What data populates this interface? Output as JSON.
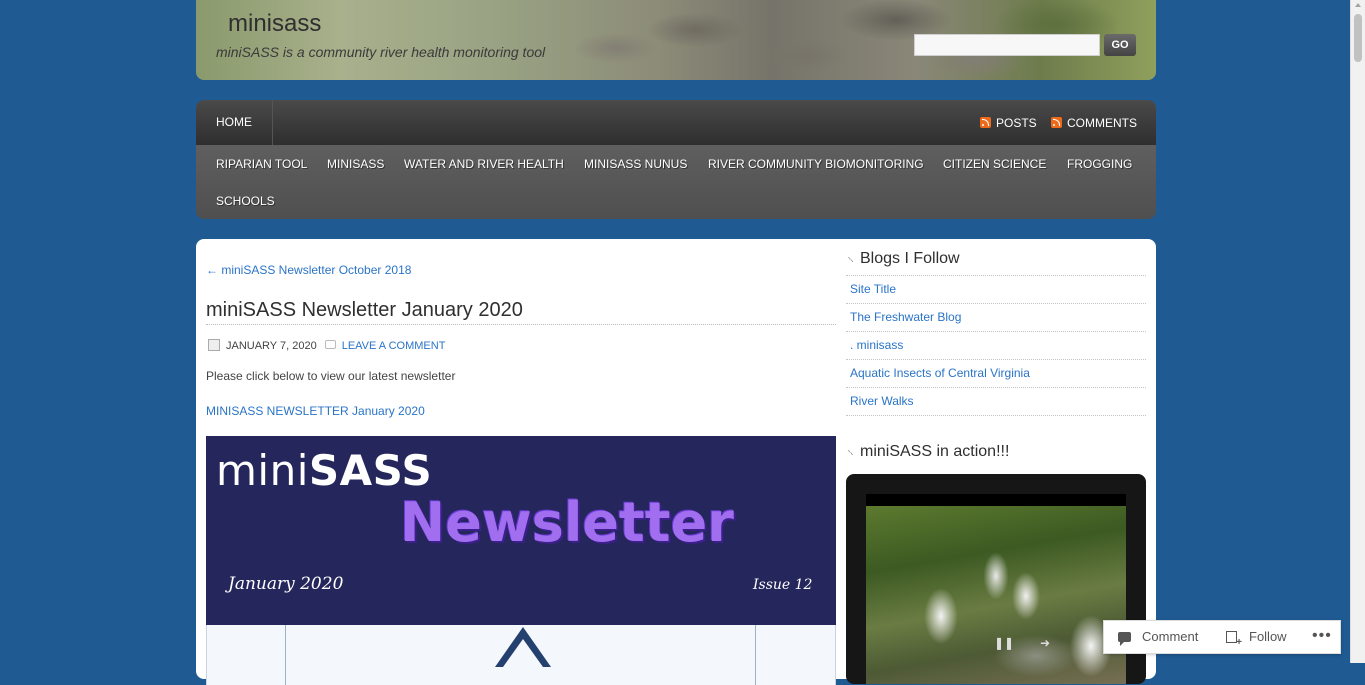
{
  "header": {
    "title": "minisass",
    "description": "miniSASS is a community river health monitoring tool",
    "search_placeholder": "",
    "search_button": "GO"
  },
  "nav": {
    "home": "HOME",
    "feeds": [
      "POSTS",
      "COMMENTS"
    ],
    "categories": [
      "RIPARIAN TOOL",
      "MINISASS",
      "WATER AND RIVER HEALTH",
      "MINISASS NUNUS",
      "RIVER COMMUNITY BIOMONITORING",
      "CITIZEN SCIENCE",
      "FROGGING",
      "SCHOOLS"
    ]
  },
  "post": {
    "prev_link": "← miniSASS Newsletter October 2018",
    "title": "miniSASS Newsletter January 2020",
    "date": "JANUARY 7, 2020",
    "comment_link": "LEAVE A COMMENT",
    "intro": "Please click below to view our latest newsletter",
    "newsletter_link": "MINISASS NEWSLETTER January 2020",
    "newsletter_image": {
      "mini": "mini",
      "sass": "SASS",
      "word": "Newsletter",
      "date": "January 2020",
      "issue": "Issue 12"
    }
  },
  "sidebar": {
    "blogs_title": "Blogs I Follow",
    "blogs": [
      "Site Title",
      "The Freshwater Blog",
      ". minisass",
      "Aquatic Insects of Central Virginia",
      "River Walks"
    ],
    "video_title": "miniSASS in action!!!",
    "video_controls": [
      "❚❚",
      "➜"
    ]
  },
  "actionbar": {
    "comment": "Comment",
    "follow": "Follow",
    "more": "•••"
  },
  "colors": {
    "background": "#1f5a92",
    "link": "#2a74c8",
    "nav_dark": "#3a3a3a",
    "newsletter_bg": "#25275c",
    "newsletter_accent": "#a26ef0"
  }
}
